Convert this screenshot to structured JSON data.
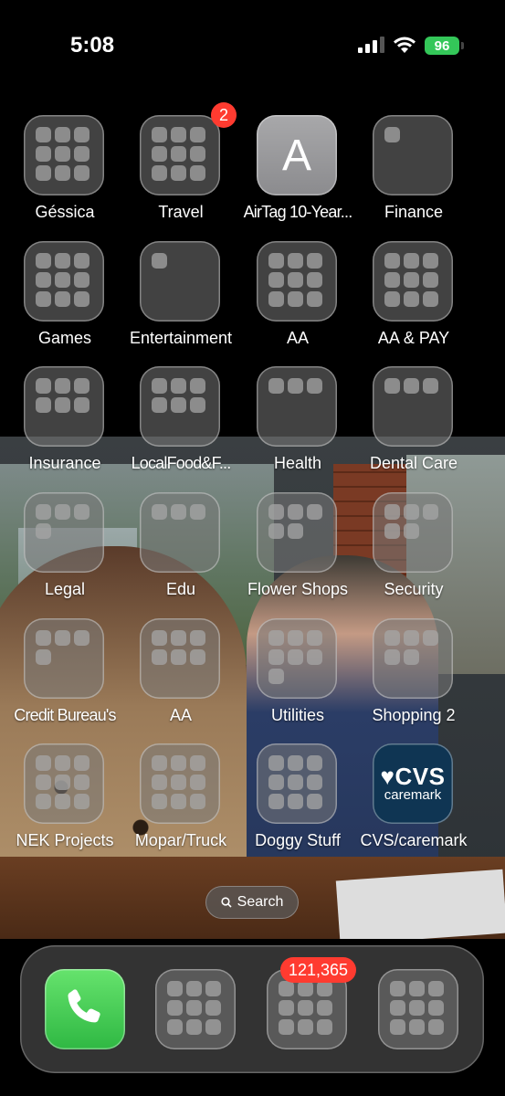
{
  "status_bar": {
    "time": "5:08",
    "battery": "96"
  },
  "apps": [
    {
      "label": "Géssica",
      "type": "folder",
      "dots": 9
    },
    {
      "label": "Travel",
      "type": "folder",
      "dots": 9,
      "badge": "2"
    },
    {
      "label": "AirTag 10-Year...",
      "type": "app",
      "letter": "A"
    },
    {
      "label": "Finance",
      "type": "folder",
      "dots": 1
    },
    {
      "label": "Games",
      "type": "folder",
      "dots": 9
    },
    {
      "label": "Entertainment",
      "type": "folder",
      "dots": 1
    },
    {
      "label": "AA",
      "type": "folder",
      "dots": 9
    },
    {
      "label": "AA & PAY",
      "type": "folder",
      "dots": 9
    },
    {
      "label": "Insurance",
      "type": "folder",
      "dots": 6
    },
    {
      "label": "LocalFood&F...",
      "type": "folder",
      "dots": 6
    },
    {
      "label": "Health",
      "type": "folder",
      "dots": 3
    },
    {
      "label": "Dental Care",
      "type": "folder",
      "dots": 3
    },
    {
      "label": "Legal",
      "type": "folder",
      "dots": 4
    },
    {
      "label": "Edu",
      "type": "folder",
      "dots": 3
    },
    {
      "label": "Flower Shops",
      "type": "folder",
      "dots": 5
    },
    {
      "label": "Security",
      "type": "folder",
      "dots": 5
    },
    {
      "label": "Credit Bureau's",
      "type": "folder",
      "dots": 4
    },
    {
      "label": "AA",
      "type": "folder",
      "dots": 6
    },
    {
      "label": "Utilities",
      "type": "folder",
      "dots": 7
    },
    {
      "label": "Shopping 2",
      "type": "folder",
      "dots": 5
    },
    {
      "label": "NEK Projects",
      "type": "folder",
      "dots": 9
    },
    {
      "label": "Mopar/Truck",
      "type": "folder",
      "dots": 9
    },
    {
      "label": "Doggy Stuff",
      "type": "folder",
      "dots": 9
    },
    {
      "label": "CVS/caremark",
      "type": "cvs",
      "cvs_main": "♥CVS",
      "cvs_sub": "caremark"
    }
  ],
  "search": {
    "label": "Search",
    "icon": "search-icon"
  },
  "dock": [
    {
      "name": "phone",
      "type": "phone",
      "icon": "phone-icon"
    },
    {
      "name": "folder-1",
      "type": "folder",
      "dots": 9
    },
    {
      "name": "folder-2",
      "type": "folder",
      "dots": 9,
      "badge": "121,365"
    },
    {
      "name": "folder-3",
      "type": "folder",
      "dots": 9
    }
  ],
  "colors": {
    "badge": "#ff3b30",
    "battery": "#34c759",
    "phone": "#3cc553",
    "cvs": "#0f3553"
  }
}
